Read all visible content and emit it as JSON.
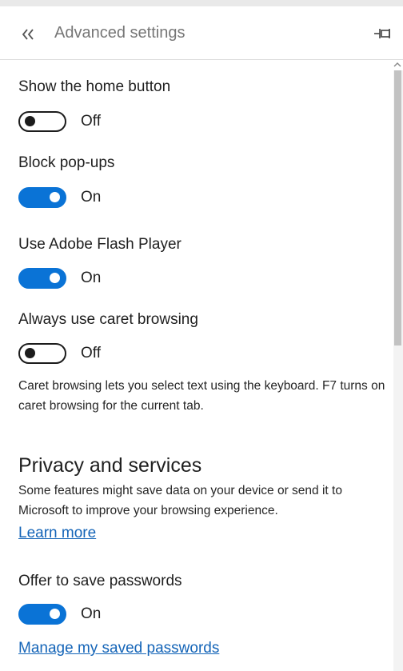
{
  "header": {
    "title": "Advanced settings",
    "back_icon": "double-chevron-left-icon",
    "pin_icon": "pin-icon"
  },
  "settings": [
    {
      "label": "Show the home button",
      "state": "Off"
    },
    {
      "label": "Block pop-ups",
      "state": "On"
    },
    {
      "label": "Use Adobe Flash Player",
      "state": "On"
    },
    {
      "label": "Always use caret browsing",
      "state": "Off",
      "help": "Caret browsing lets you select text using the keyboard. F7 turns on caret browsing for the current tab."
    }
  ],
  "privacy": {
    "title": "Privacy and services",
    "description": "Some features might save data on your device or send it to Microsoft to improve your browsing experience.",
    "learn_more": "Learn more",
    "offer_label": "Offer to save passwords",
    "offer_state": "On",
    "manage_link": "Manage my saved passwords"
  },
  "colors": {
    "accent": "#0a73d6",
    "link": "#1565b8"
  }
}
